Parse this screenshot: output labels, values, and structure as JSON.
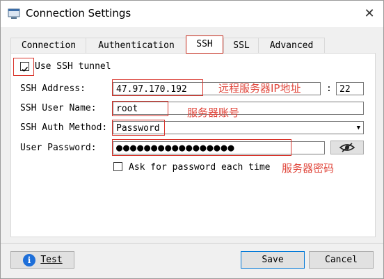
{
  "window": {
    "title": "Connection Settings",
    "close_glyph": "✕"
  },
  "tabs": [
    {
      "label": "Connection",
      "active": false
    },
    {
      "label": "Authentication",
      "active": false
    },
    {
      "label": "SSH",
      "active": true
    },
    {
      "label": "SSL",
      "active": false
    },
    {
      "label": "Advanced",
      "active": false
    }
  ],
  "ssh": {
    "use_tunnel_label": "Use SSH tunnel",
    "use_tunnel_checked": true,
    "address_label": "SSH Address:",
    "address_value": "47.97.170.192",
    "port_separator": ":",
    "port_value": "22",
    "user_label": "SSH User Name:",
    "user_value": "root",
    "auth_method_label": "SSH Auth Method:",
    "auth_method_value": "Password",
    "password_label": "User Password:",
    "password_masked": "●●●●●●●●●●●●●●●●●",
    "ask_password_label": "Ask for password each time",
    "ask_password_checked": false
  },
  "annotations": {
    "address_note": "远程服务器IP地址",
    "user_note": "服务器账号",
    "password_note": "服务器密码"
  },
  "footer": {
    "test_label": "Test",
    "save_label": "Save",
    "cancel_label": "Cancel"
  },
  "icons": {
    "app": "database-window-icon",
    "info": "info-icon",
    "eye": "eye-slash-icon",
    "dropdown": "chevron-down-icon"
  },
  "colors": {
    "annotation": "#e0453a",
    "accent": "#0078d7",
    "info": "#1e6fd9"
  }
}
